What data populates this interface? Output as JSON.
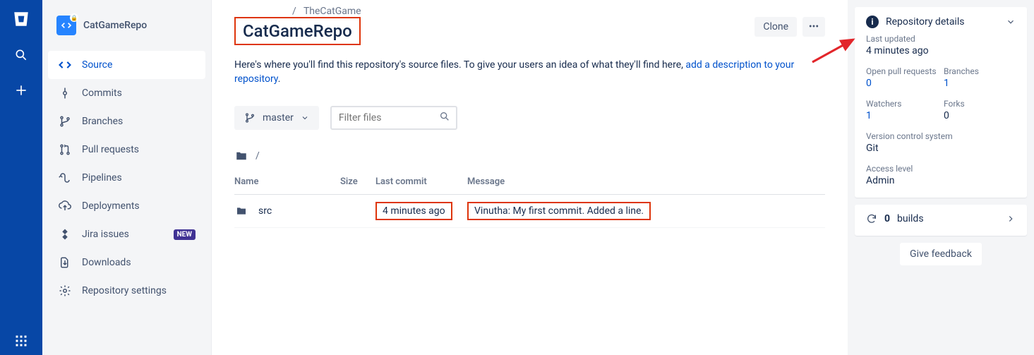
{
  "global_nav": {
    "logo": "bitbucket",
    "search": "search-icon",
    "add": "plus-icon",
    "apps": "apps-icon"
  },
  "sidebar": {
    "repo_name": "CatGameRepo",
    "items": [
      {
        "label": "Source",
        "icon": "code-icon",
        "active": true
      },
      {
        "label": "Commits",
        "icon": "commit-icon"
      },
      {
        "label": "Branches",
        "icon": "branch-icon"
      },
      {
        "label": "Pull requests",
        "icon": "pull-request-icon"
      },
      {
        "label": "Pipelines",
        "icon": "pipeline-icon"
      },
      {
        "label": "Deployments",
        "icon": "deploy-icon"
      },
      {
        "label": "Jira issues",
        "icon": "jira-icon",
        "badge": "NEW"
      },
      {
        "label": "Downloads",
        "icon": "download-icon"
      },
      {
        "label": "Repository settings",
        "icon": "settings-icon"
      }
    ]
  },
  "breadcrumb": {
    "sep": "/",
    "project": "TheCatGame"
  },
  "page_title": "CatGameRepo",
  "actions": {
    "clone": "Clone",
    "more": "•••"
  },
  "description": {
    "text": "Here's where you'll find this repository's source files. To give your users an idea of what they'll find here, ",
    "link": "add a description to your repository",
    "dot": "."
  },
  "toolbar": {
    "branch": "master",
    "filter_placeholder": "Filter files"
  },
  "path_sep": "/",
  "table": {
    "headers": [
      "Name",
      "Size",
      "Last commit",
      "Message"
    ],
    "rows": [
      {
        "name": "src",
        "size": "",
        "last_commit": "4 minutes ago",
        "message": "Vinutha: My first commit. Added a line."
      }
    ]
  },
  "details": {
    "title": "Repository details",
    "last_updated_label": "Last updated",
    "last_updated_value": "4 minutes ago",
    "stats": {
      "open_pr_label": "Open pull requests",
      "open_pr_value": "0",
      "branches_label": "Branches",
      "branches_value": "1",
      "watchers_label": "Watchers",
      "watchers_value": "1",
      "forks_label": "Forks",
      "forks_value": "0",
      "vcs_label": "Version control system",
      "vcs_value": "Git",
      "access_label": "Access level",
      "access_value": "Admin"
    },
    "builds_count": "0",
    "builds_label": "builds",
    "feedback": "Give feedback"
  }
}
